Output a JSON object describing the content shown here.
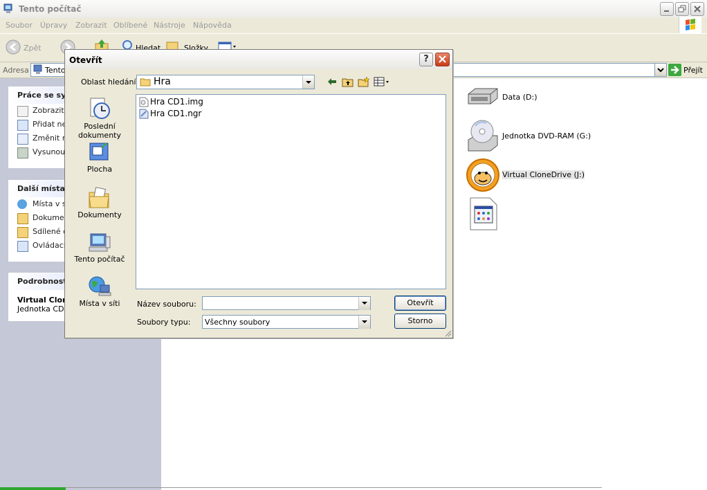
{
  "window": {
    "title": "Tento počítač",
    "menu": [
      "Soubor",
      "Úpravy",
      "Zobrazit",
      "Oblíbené",
      "Nástroje",
      "Nápověda"
    ],
    "toolbar": {
      "back": "Zpět",
      "search": "Hledat",
      "folders": "Složky"
    },
    "address": {
      "label": "Adresa",
      "value": "Tento",
      "go": "Přejít"
    }
  },
  "leftpane": {
    "system_tasks": {
      "title": "Práce se sys",
      "items": [
        "Zobrazit s",
        "Přidat neb",
        "Změnit na",
        "Vysunout"
      ]
    },
    "other_places": {
      "title": "Další místa",
      "items": [
        "Místa v sí",
        "Dokument",
        "Sdílené do",
        "Ovládací p"
      ]
    },
    "details": {
      "title": "Podrobnosti",
      "name": "Virtual Clone",
      "desc": "Jednotka CD-R"
    }
  },
  "drives": [
    {
      "label": "Data (D:)",
      "icon": "hard-drive-icon"
    },
    {
      "label": "Jednotka DVD-RAM (G:)",
      "icon": "dvd-drive-icon"
    },
    {
      "label": "Virtual CloneDrive (J:)",
      "icon": "clonedrive-sheep-icon"
    },
    {
      "label": "",
      "icon": "control-panel-file-icon"
    }
  ],
  "dialog": {
    "title": "Otevřít",
    "help": "?",
    "look_in_label": "Oblast hledání:",
    "look_in_value": "Hra",
    "places": [
      "Poslední dokumenty",
      "Plocha",
      "Dokumenty",
      "Tento počítač",
      "Místa v síti"
    ],
    "files": [
      "Hra CD1.img",
      "Hra CD1.ngr"
    ],
    "filename_label": "Název souboru:",
    "filename_value": "",
    "filetype_label": "Soubory typu:",
    "filetype_value": "Všechny soubory",
    "open_button": "Otevřít",
    "cancel_button": "Storno"
  }
}
